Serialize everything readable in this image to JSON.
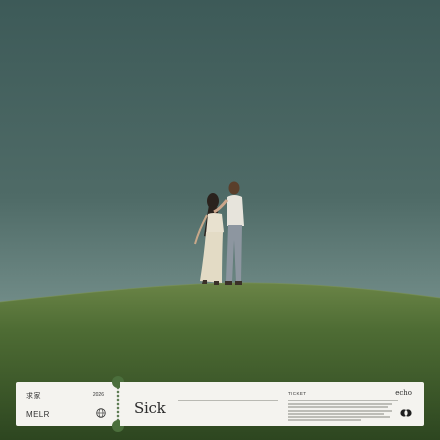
{
  "cover": {
    "artist": "MELR",
    "title": "Sick",
    "year": "2026",
    "brand_cjk": "求家",
    "ticket_label": "TICKET",
    "label_logo": "echo",
    "icons": {
      "globe": "globe-icon",
      "circles": "overlapping-circles-icon"
    },
    "colors": {
      "sky_top": "#3d5a58",
      "sky_bottom": "#8ea6a0",
      "grass_top": "#5f7d3e",
      "grass_bottom": "#2f4a22",
      "ticket": "#f4f3ef",
      "ink": "#2c2c2c"
    }
  }
}
